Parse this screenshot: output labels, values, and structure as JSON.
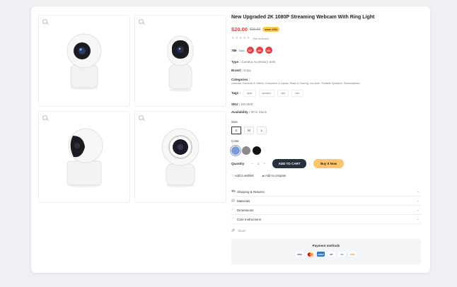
{
  "product": {
    "title": "New Upgraded 2K 1080P Streaming Webcam With Ring Light",
    "price": "$20.00",
    "old_price": "$26.00",
    "save_badge": "save 23%",
    "reviews": "(No reviews)",
    "sold_count": "789",
    "sold_label": "Sold",
    "countdown": [
      "07",
      "00",
      "06"
    ],
    "type_label": "Type :",
    "type_value": "Camera Accessory Sets",
    "brand_label": "Brand :",
    "brand_value": "Gopy",
    "categories_label": "Categories :",
    "categories_value": "cameras, Cameras & Videos, Computers & Laptop, Music & Gaming, our store, Portable Speakers, Smartwatches",
    "tags_label": "Tags :",
    "tags": [
      "apps",
      "speaker",
      "vice",
      "wire"
    ],
    "sku_label": "SKU :",
    "sku_value": "SKU000",
    "availability_label": "Availability :",
    "availability_value": "30 in Stock",
    "size_label": "Size",
    "sizes": [
      "S",
      "M",
      "L"
    ],
    "color_label": "Color",
    "colors": [
      "#7e9ad8",
      "#8a8a8a",
      "#111111"
    ],
    "quantity_label": "Quantity",
    "quantity_value": "1",
    "add_to_cart": "ADD TO CART",
    "buy_now": "Buy It Now",
    "wishlist": "Add to wishlist",
    "compare": "Add to compare",
    "accordion": [
      "Shipping & Returns",
      "Materials",
      "Dimensions",
      "Care Instructions"
    ],
    "share": "Share",
    "payment_title": "Payment methods",
    "payment_icons": [
      "VISA",
      "MC",
      "AMEX",
      "PP",
      "DC",
      "DISC"
    ]
  },
  "colors": {
    "accent_red": "#e23c3c",
    "save_badge": "#ffc94a",
    "cart_button": "#26313d",
    "buy_button": "#ffc56b"
  }
}
